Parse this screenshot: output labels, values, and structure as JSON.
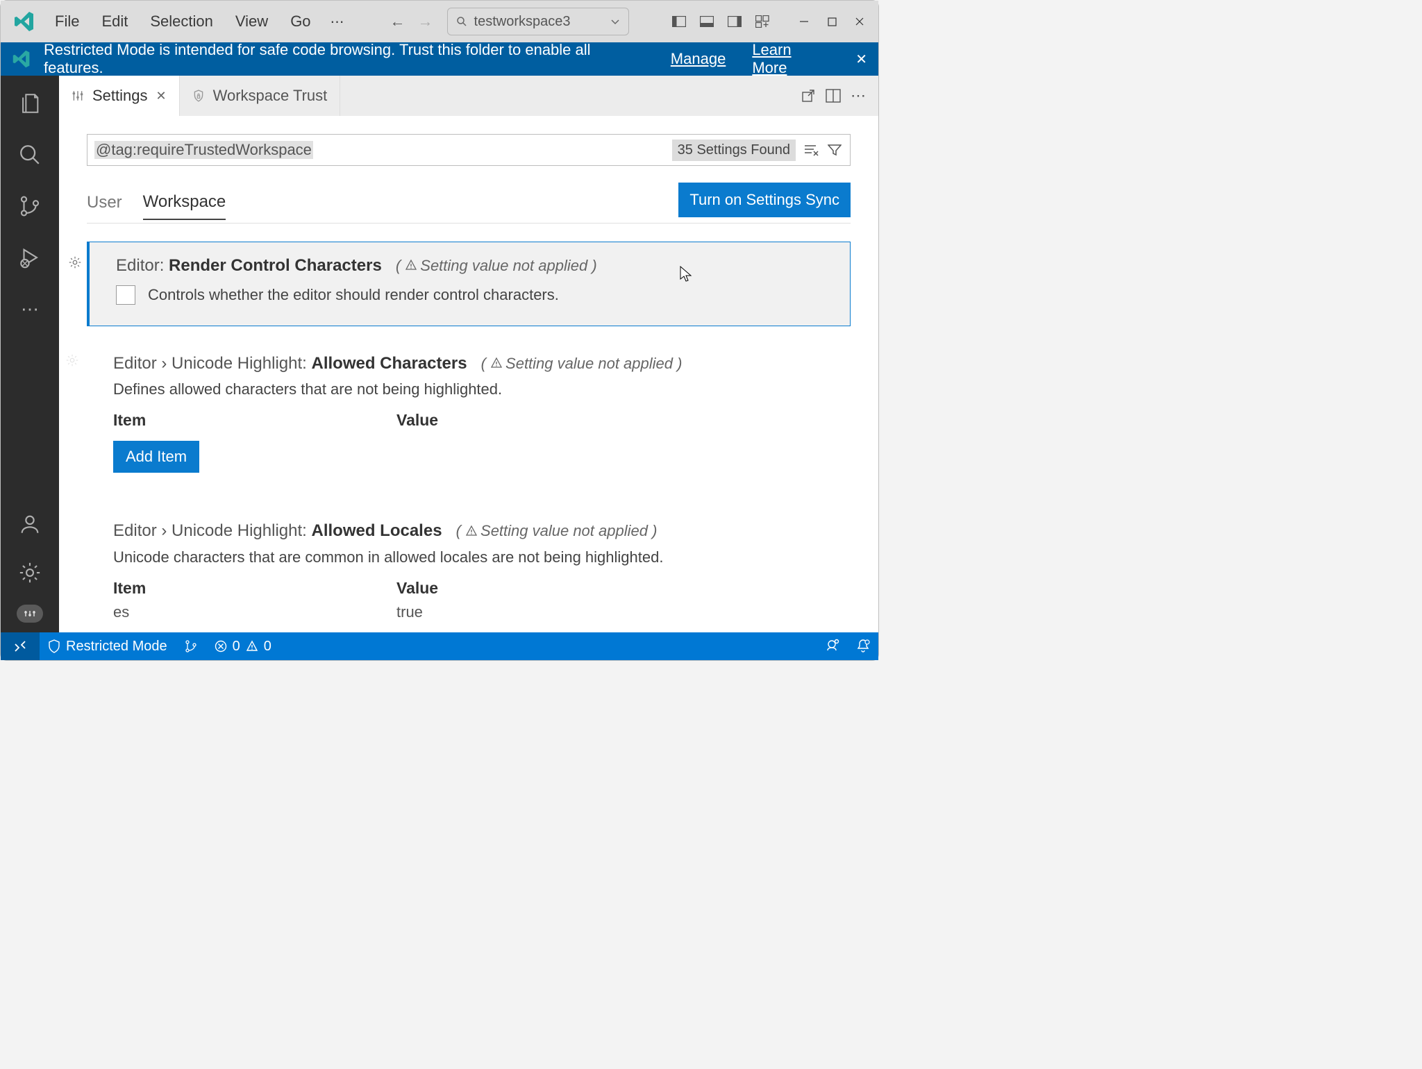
{
  "titlebar": {
    "menus": [
      "File",
      "Edit",
      "Selection",
      "View",
      "Go"
    ],
    "search_text": "testworkspace3"
  },
  "banner": {
    "message": "Restricted Mode is intended for safe code browsing. Trust this folder to enable all features.",
    "manage": "Manage",
    "learn_more": "Learn More"
  },
  "tabs": {
    "settings": "Settings",
    "workspace_trust": "Workspace Trust"
  },
  "settings": {
    "search_value": "@tag:requireTrustedWorkspace",
    "found_label": "35 Settings Found",
    "scope_user": "User",
    "scope_workspace": "Workspace",
    "sync_button": "Turn on Settings Sync",
    "not_applied_label": "Setting value not applied",
    "items": [
      {
        "category": "Editor:",
        "name": "Render Control Characters",
        "desc": "Controls whether the editor should render control characters."
      },
      {
        "category": "Editor › Unicode Highlight:",
        "name": "Allowed Characters",
        "desc": "Defines allowed characters that are not being highlighted.",
        "col_item": "Item",
        "col_value": "Value",
        "add_item": "Add Item"
      },
      {
        "category": "Editor › Unicode Highlight:",
        "name": "Allowed Locales",
        "desc": "Unicode characters that are common in allowed locales are not being highlighted.",
        "col_item": "Item",
        "col_value": "Value",
        "row_item": "es",
        "row_value": "true"
      }
    ]
  },
  "statusbar": {
    "restricted": "Restricted Mode",
    "errors": "0",
    "warnings": "0"
  }
}
